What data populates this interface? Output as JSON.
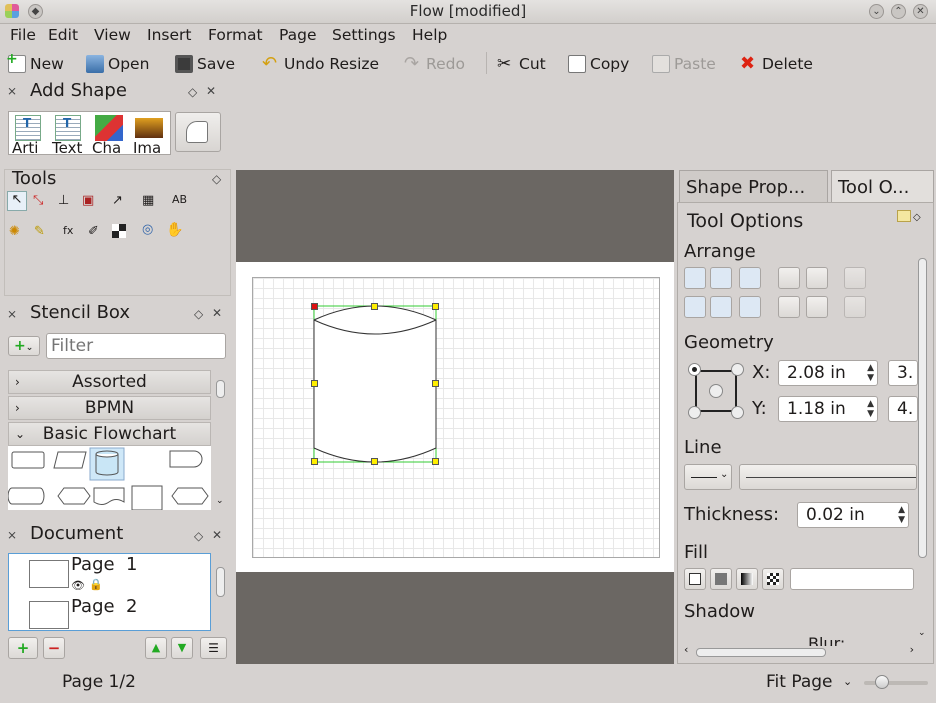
{
  "window": {
    "title": "Flow [modified]"
  },
  "menu": [
    "File",
    "Edit",
    "View",
    "Insert",
    "Format",
    "Page",
    "Settings",
    "Help"
  ],
  "toolbar": {
    "new": "New",
    "open": "Open",
    "save": "Save",
    "undo": "Undo Resize",
    "redo": "Redo",
    "cut": "Cut",
    "copy": "Copy",
    "paste": "Paste",
    "delete": "Delete"
  },
  "add_shape": {
    "title": "Add Shape",
    "items": [
      "Arti",
      "Text",
      "Cha",
      "Ima"
    ]
  },
  "tools": {
    "title": "Tools"
  },
  "stencil": {
    "title": "Stencil Box",
    "filter_placeholder": "Filter",
    "categories": [
      "Assorted",
      "BPMN",
      "Basic Flowchart"
    ]
  },
  "document": {
    "title": "Document",
    "pages": [
      "Page  1",
      "Page  2"
    ]
  },
  "right_panel": {
    "tabs": [
      "Shape Prop...",
      "Tool O..."
    ],
    "heading": "Tool Options",
    "arrange": "Arrange",
    "geometry": "Geometry",
    "x_label": "X:",
    "x_value": "2.08 in",
    "x_value2": "3.",
    "y_label": "Y:",
    "y_value": "1.18 in",
    "y_value2": "4.",
    "line": "Line",
    "thickness_label": "Thickness:",
    "thickness_value": "0.02 in",
    "fill": "Fill",
    "shadow": "Shadow",
    "blur": "Blur:"
  },
  "status": {
    "page": "Page 1/2",
    "zoom": "Fit Page"
  },
  "colors": {
    "canvas_bg": "#6b6763",
    "selection": "#33cc33",
    "handle": "#ffef00",
    "handle_anchor": "#dd1111"
  }
}
